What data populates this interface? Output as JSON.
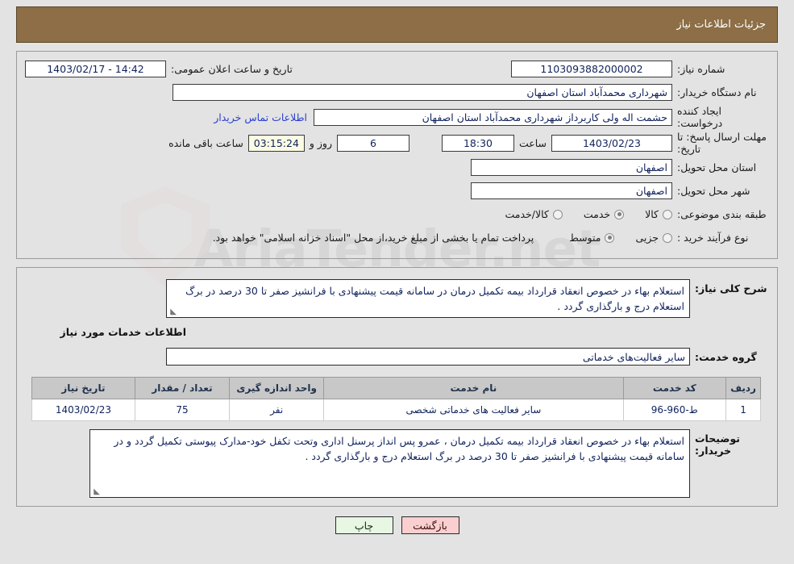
{
  "header": {
    "title": "جزئیات اطلاعات نیاز"
  },
  "watermark": {
    "text": "AriaTender.net"
  },
  "form": {
    "need_number_label": "شماره نیاز:",
    "need_number_value": "1103093882000002",
    "buyer_org_label": "نام دستگاه خریدار:",
    "buyer_org_value": "شهرداری محمدآباد استان اصفهان",
    "creator_label": "ایجاد کننده درخواست:",
    "creator_value": "حشمت اله ولی کاربرداز شهرداری محمدآباد استان اصفهان",
    "deadline_label": "مهلت ارسال پاسخ: تا تاریخ:",
    "deadline_date": "1403/02/23",
    "time_label": "ساعت",
    "time_value": "18:30",
    "days_value": "6",
    "days_label": "روز و",
    "timer_value": "03:15:24",
    "timer_label": "ساعت باقی مانده",
    "province_label": "استان محل تحویل:",
    "province_value": "اصفهان",
    "city_label": "شهر محل تحویل:",
    "city_value": "اصفهان",
    "publish_label": "تاریخ و ساعت اعلان عمومی:",
    "publish_value": "1403/02/17 - 14:42",
    "contact_link": "اطلاعات تماس خریدار"
  },
  "classification": {
    "label": "طبقه بندی موضوعی:",
    "options": [
      {
        "label": "کالا",
        "checked": false
      },
      {
        "label": "خدمت",
        "checked": true
      },
      {
        "label": "کالا/خدمت",
        "checked": false
      }
    ]
  },
  "process": {
    "label": "نوع فرآیند خرید :",
    "options": [
      {
        "label": "جزیی",
        "checked": false
      },
      {
        "label": "متوسط",
        "checked": true
      }
    ],
    "note": "پرداخت تمام یا بخشی از مبلغ خرید،از محل \"اسناد خزانه اسلامی\" خواهد بود."
  },
  "need_description": {
    "label": "شرح کلی نیاز:",
    "value": "استعلام بهاء در خصوص انعقاد قرارداد بیمه تکمیل درمان در سامانه قیمت پیشنهادی با فرانشیز صفر تا 30 درصد در برگ استعلام درج و بارگذاری گردد ."
  },
  "services_section": {
    "title": "اطلاعات خدمات مورد نیاز",
    "group_label": "گروه خدمت:",
    "group_value": "سایر فعالیت‌های خدماتی"
  },
  "items_table": {
    "columns": [
      "ردیف",
      "کد خدمت",
      "نام خدمت",
      "واحد اندازه گیری",
      "تعداد / مقدار",
      "تاریخ نیاز"
    ],
    "rows": [
      {
        "radif": "1",
        "code": "ط-960-96",
        "name": "سایر فعالیت های خدماتی شخصی",
        "unit": "نفر",
        "qty": "75",
        "date": "1403/02/23"
      }
    ]
  },
  "buyer_notes": {
    "label": "توضیحات خریدار:",
    "value": "استعلام بهاء در خصوص انعقاد قرارداد بیمه تکمیل درمان ، عمرو پس انداز پرسنل اداری وتحت تکفل خود-مدارک پیوستی تکمیل گردد و در سامانه قیمت پیشنهادی با فرانشیز صفر تا 30 درصد در برگ استعلام درج و بارگذاری گردد ."
  },
  "footer": {
    "print_label": "چاپ",
    "back_label": "بازگشت"
  },
  "colors": {
    "header_bg": "#8d6e46",
    "panel_border": "#9a9a9a",
    "page_bg": "#e3e3e3",
    "link": "#2a3fd0",
    "print_btn": "#e7f7e3",
    "back_btn": "#f9cfcf",
    "timer_bg": "#fbfbe4",
    "table_header_bg": "#c8c8c8"
  }
}
